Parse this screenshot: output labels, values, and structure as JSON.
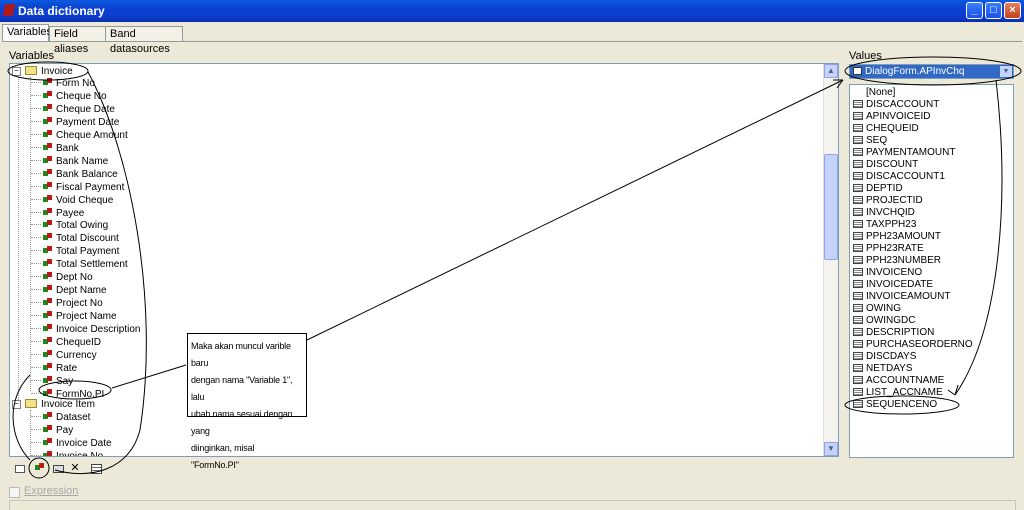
{
  "window": {
    "title": "Data dictionary"
  },
  "tabs": [
    "Variables",
    "Field aliases",
    "Band datasources"
  ],
  "variables_label": "Variables",
  "values_label": "Values",
  "tree": {
    "group1": "Invoice",
    "group1_items": [
      "Form No",
      "Cheque No",
      "Cheque Date",
      "Payment Date",
      "Cheque Amount",
      "Bank",
      "Bank Name",
      "Bank Balance",
      "Fiscal Payment",
      "Void Cheque",
      "Payee",
      "Total Owing",
      "Total Discount",
      "Total Payment",
      "Total Settlement",
      "Dept No",
      "Dept Name",
      "Project No",
      "Project Name",
      "Invoice Description",
      "ChequeID",
      "Currency",
      "Rate",
      "Say",
      "FormNo.PI"
    ],
    "group2": "Invoice Item",
    "group2_items": [
      "Dataset",
      "Pay",
      "Invoice Date",
      "Invoice No"
    ]
  },
  "values": {
    "selected": "DialogForm.APInvChq",
    "items": [
      "[None]",
      "DISCACCOUNT",
      "APINVOICEID",
      "CHEQUEID",
      "SEQ",
      "PAYMENTAMOUNT",
      "DISCOUNT",
      "DISCACCOUNT1",
      "DEPTID",
      "PROJECTID",
      "INVCHQID",
      "TAXPPH23",
      "PPH23AMOUNT",
      "PPH23RATE",
      "PPH23NUMBER",
      "INVOICENO",
      "INVOICEDATE",
      "INVOICEAMOUNT",
      "OWING",
      "OWINGDC",
      "DESCRIPTION",
      "PURCHASEORDERNO",
      "DISCDAYS",
      "NETDAYS",
      "ACCOUNTNAME",
      "LIST_ACCNAME",
      "SEQUENCENO"
    ]
  },
  "expression_label": "Expression",
  "callout": {
    "lines": [
      "Maka akan muncul varible baru",
      "dengan nama \"Variable 1\", lalu",
      "ubah nama sesuai dengan yang",
      "diinginkan, misal \"FormNo.PI\""
    ]
  },
  "icons": {
    "tree_folder": "folder-icon",
    "tree_variable": "variable-icon",
    "value_field": "field-icon",
    "toolbar": [
      "new-category-icon",
      "new-variable-icon",
      "edit-icon",
      "delete-icon",
      "properties-icon"
    ]
  },
  "colors": {
    "titlebar": "#0b3fd1",
    "selection": "#3169c6",
    "dialog_bg": "#ece9d8"
  }
}
